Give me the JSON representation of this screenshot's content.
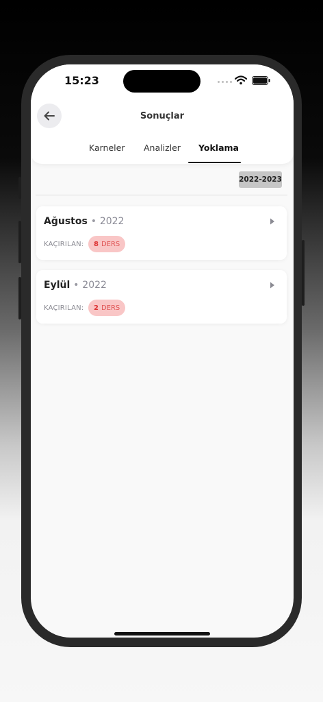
{
  "status_bar": {
    "time": "15:23"
  },
  "header": {
    "title": "Sonuçlar",
    "tabs": [
      {
        "label": "Karneler",
        "active": false
      },
      {
        "label": "Analizler",
        "active": false
      },
      {
        "label": "Yoklama",
        "active": true
      }
    ]
  },
  "year_filter": {
    "selected": "2022-2023"
  },
  "attendance": [
    {
      "month": "Ağustos",
      "separator": "•",
      "year": "2022",
      "missed_label": "KAÇIRILAN:",
      "missed_count": "8",
      "missed_unit": "DERS"
    },
    {
      "month": "Eylül",
      "separator": "•",
      "year": "2022",
      "missed_label": "KAÇIRILAN:",
      "missed_count": "2",
      "missed_unit": "DERS"
    }
  ],
  "colors": {
    "accent": "#111111",
    "badge_bg": "#f9c6c6",
    "badge_text": "#e05555"
  },
  "icons": {
    "back": "arrow-left-icon",
    "chevron": "caret-right-icon",
    "wifi": "wifi-icon",
    "battery": "battery-icon"
  }
}
